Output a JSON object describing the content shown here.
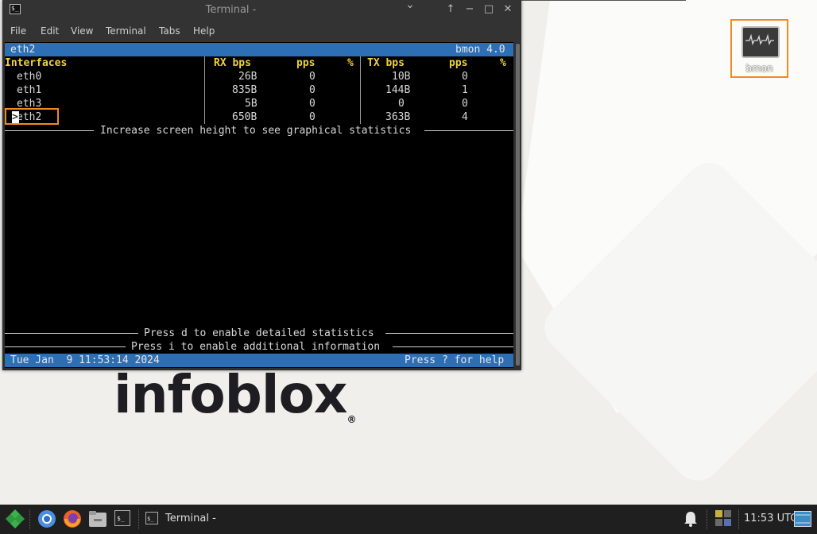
{
  "window": {
    "title": "Terminal -",
    "menu": [
      "File",
      "Edit",
      "View",
      "Terminal",
      "Tabs",
      "Help"
    ]
  },
  "bmon": {
    "top_left": "eth2",
    "version": "bmon 4.0",
    "headers": [
      "Interfaces",
      "RX bps",
      "pps",
      "%",
      "TX bps",
      "pps",
      "%"
    ],
    "rows": [
      {
        "iface": "eth0",
        "rx_bps": "26B",
        "rx_pps": "0",
        "tx_bps": "10B",
        "tx_pps": "0"
      },
      {
        "iface": "eth1",
        "rx_bps": "835B",
        "rx_pps": "0",
        "tx_bps": "144B",
        "tx_pps": "1"
      },
      {
        "iface": "eth3",
        "rx_bps": "5B",
        "rx_pps": "0",
        "tx_bps": "0",
        "tx_pps": "0"
      },
      {
        "iface": "eth2",
        "rx_bps": "650B",
        "rx_pps": "0",
        "tx_bps": "363B",
        "tx_pps": "4"
      }
    ],
    "selected_marker": ">",
    "graph_hint": "Increase screen height to see graphical statistics",
    "detail_hint": "Press d to enable detailed statistics",
    "info_hint": "Press i to enable additional information",
    "datetime": "Tue Jan  9 11:53:14 2024",
    "help_hint": "Press ? for help"
  },
  "desktop": {
    "icon_label": "bmon",
    "logo_text": "infoblox"
  },
  "taskbar": {
    "task_label": "Terminal -",
    "clock": "11:53 UTC"
  },
  "colors": {
    "highlight_box": "#f08a24",
    "status_bar": "#2c6fb5",
    "header_yellow": "#f0d23a"
  }
}
